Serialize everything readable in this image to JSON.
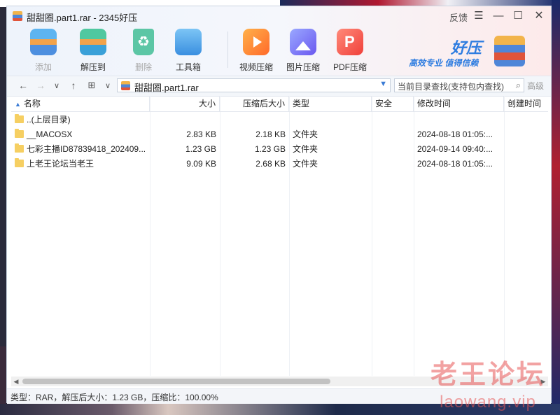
{
  "window": {
    "title": "甜甜圈.part1.rar - 2345好压",
    "feedback": "反馈",
    "controls": {
      "menu": "☰",
      "minimize": "—",
      "maximize": "☐",
      "close": "✕"
    }
  },
  "toolbar": {
    "items": [
      {
        "label": "添加",
        "icon": "add-archive-icon",
        "enabled": false
      },
      {
        "label": "解压到",
        "icon": "extract-icon",
        "enabled": true
      },
      {
        "label": "删除",
        "icon": "recycle-delete-icon",
        "enabled": false
      },
      {
        "label": "工具箱",
        "icon": "toolbox-icon",
        "enabled": true
      },
      {
        "label": "视频压缩",
        "icon": "video-compress-icon",
        "enabled": true
      },
      {
        "label": "图片压缩",
        "icon": "image-compress-icon",
        "enabled": true
      },
      {
        "label": "PDF压缩",
        "icon": "pdf-compress-icon",
        "enabled": true
      }
    ]
  },
  "brand": {
    "name": "好压",
    "slogan": "高效专业  值得信赖"
  },
  "navbar": {
    "back": "←",
    "forward": "→",
    "history": "∨",
    "up": "↑",
    "view": "⊞",
    "view_dropdown": "∨",
    "path": "甜甜圈.part1.rar",
    "search_placeholder": "当前目录查找(支持包内查找)",
    "advanced": "高级"
  },
  "list": {
    "columns": [
      "名称",
      "大小",
      "压缩后大小",
      "类型",
      "安全",
      "修改时间",
      "创建时间"
    ],
    "rows": [
      {
        "name": "..(上层目录)",
        "size": "",
        "csize": "",
        "type": "",
        "sec": "",
        "mtime": "",
        "ctime": ""
      },
      {
        "name": "__MACOSX",
        "size": "2.83 KB",
        "csize": "2.18 KB",
        "type": "文件夹",
        "sec": "",
        "mtime": "2024-08-18 01:05:...",
        "ctime": ""
      },
      {
        "name": "七彩主播ID87839418_202409...",
        "size": "1.23 GB",
        "csize": "1.23 GB",
        "type": "文件夹",
        "sec": "",
        "mtime": "2024-09-14 09:40:...",
        "ctime": ""
      },
      {
        "name": "上老王论坛当老王",
        "size": "9.09 KB",
        "csize": "2.68 KB",
        "type": "文件夹",
        "sec": "",
        "mtime": "2024-08-18 01:05:...",
        "ctime": ""
      }
    ]
  },
  "status": {
    "text": "类型：RAR，解压后大小：1.23 GB，压缩比：100.00%"
  },
  "watermark": {
    "cn": "老王论坛",
    "url": "laowang.vip"
  },
  "colors": {
    "accent": "#3a7bd5",
    "folder": "#f6cf62",
    "watermark": "#e85555"
  }
}
